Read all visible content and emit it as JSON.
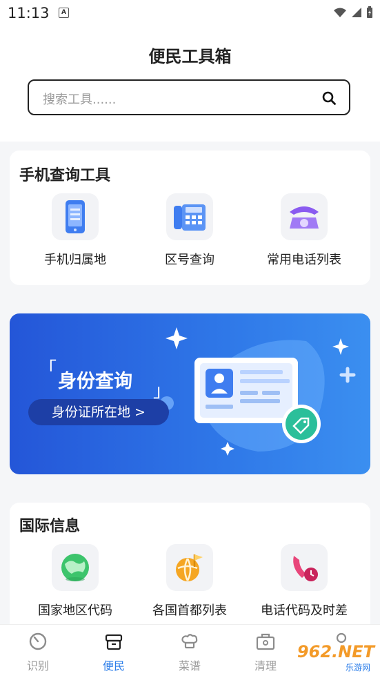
{
  "status_bar": {
    "time": "11:13",
    "notif_letter": "A"
  },
  "header": {
    "title": "便民工具箱"
  },
  "search": {
    "placeholder": "搜索工具......"
  },
  "phone_tools": {
    "title": "手机查询工具",
    "items": [
      {
        "label": "手机归属地",
        "icon": "mobile-phone-icon"
      },
      {
        "label": "区号查询",
        "icon": "desk-phone-icon"
      },
      {
        "label": "常用电话列表",
        "icon": "retro-phone-icon"
      }
    ]
  },
  "banner": {
    "title": "身份查询",
    "button": "身份证所在地 >",
    "bracket_open": "「",
    "bracket_close": "」"
  },
  "intl_info": {
    "title": "国际信息",
    "items": [
      {
        "label": "国家地区代码",
        "icon": "globe-icon"
      },
      {
        "label": "各国首都列表",
        "icon": "globe-flag-icon"
      },
      {
        "label": "电话代码及时差",
        "icon": "phone-clock-icon"
      }
    ]
  },
  "tabbar": {
    "items": [
      {
        "label": "识别",
        "icon": "clock-dial-icon"
      },
      {
        "label": "便民",
        "icon": "box-icon",
        "active": true
      },
      {
        "label": "菜谱",
        "icon": "chef-hat-icon"
      },
      {
        "label": "清理",
        "icon": "toolbox-icon"
      }
    ]
  },
  "watermark": {
    "text": "962.NET",
    "sub": "乐游网"
  },
  "colors": {
    "accent": "#2b7de9",
    "banner_start": "#2456d8",
    "banner_end": "#3b8ff0"
  }
}
